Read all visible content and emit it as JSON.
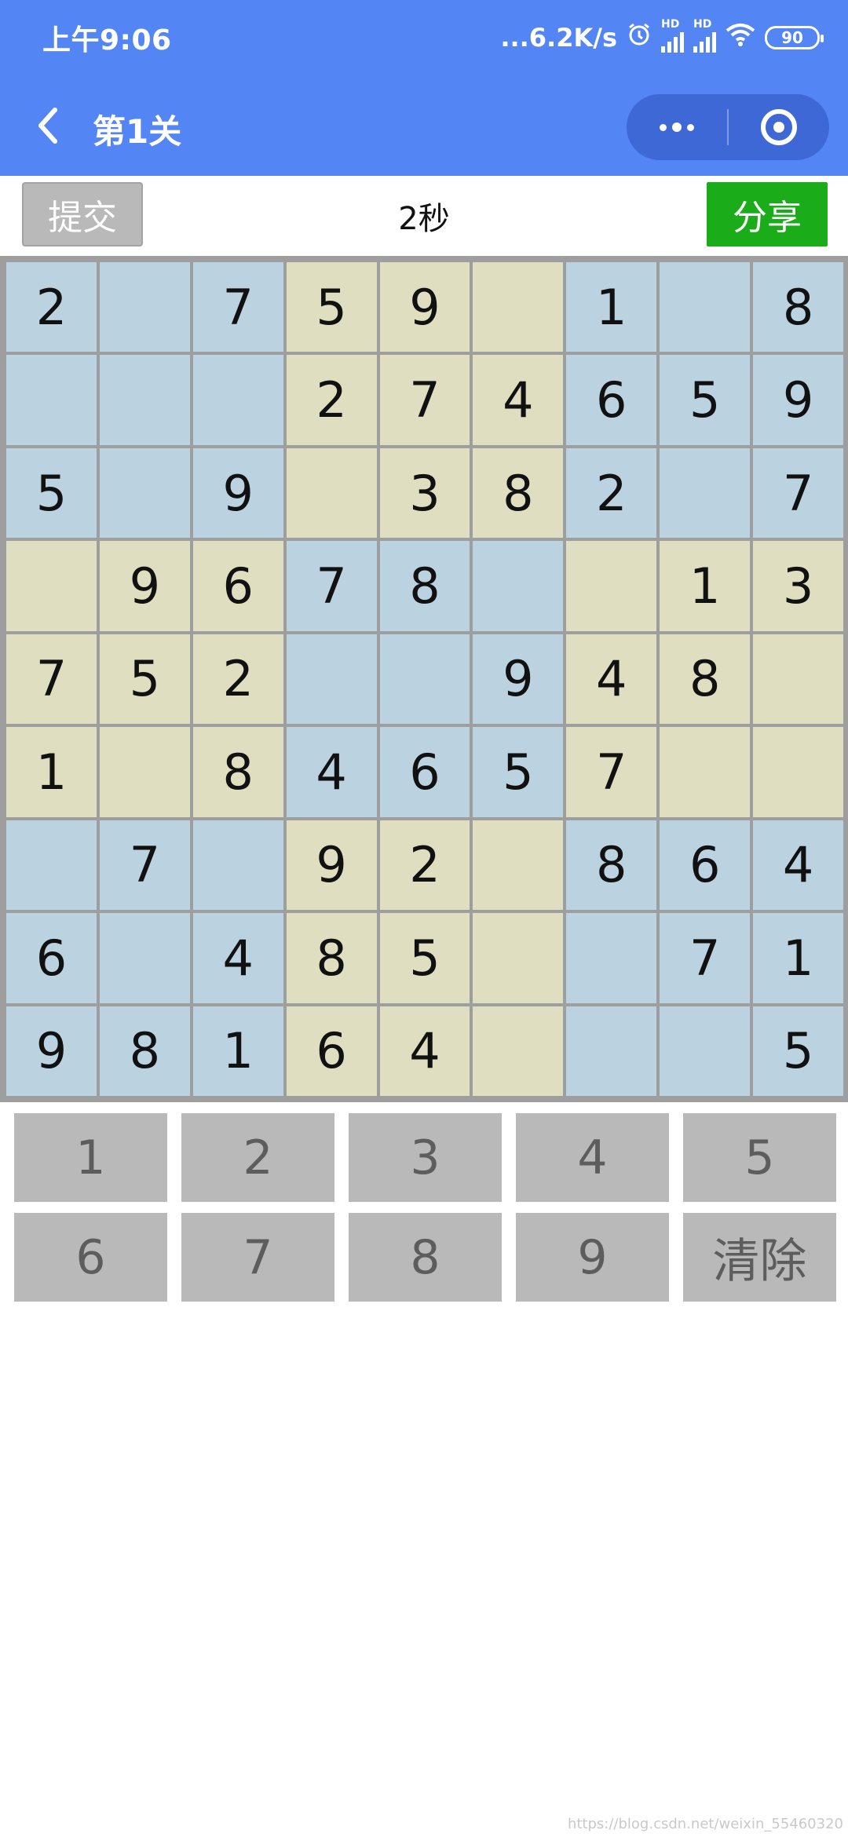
{
  "status_bar": {
    "time": "上午9:06",
    "network_speed": "...6.2K/s",
    "signal_label_1": "HD",
    "signal_label_2": "HD",
    "battery": "90",
    "icons": [
      "alarm-icon",
      "signal-icon",
      "signal-icon",
      "wifi-icon",
      "battery-icon"
    ]
  },
  "nav": {
    "title": "第1关",
    "back_icon": "chevron-left-icon",
    "menu_icon": "more-dots-icon",
    "close_icon": "target-circle-icon"
  },
  "toolbar": {
    "submit_label": "提交",
    "timer": "2秒",
    "share_label": "分享"
  },
  "colors": {
    "header": "#5485f4",
    "capsule": "#3d68d6",
    "share": "#1aad19",
    "submit": "#b9b9b9",
    "cell_blue": "#bbd2e1",
    "cell_yellow": "#e0dec0",
    "grid_line": "#9e9e9e",
    "key": "#b9b9b9"
  },
  "board": {
    "rows": [
      [
        "2",
        "",
        "7",
        "5",
        "9",
        "",
        "1",
        "",
        "8"
      ],
      [
        "",
        "",
        "",
        "2",
        "7",
        "4",
        "6",
        "5",
        "9"
      ],
      [
        "5",
        "",
        "9",
        "",
        "3",
        "8",
        "2",
        "",
        "7"
      ],
      [
        "",
        "9",
        "6",
        "7",
        "8",
        "",
        "",
        "1",
        "3"
      ],
      [
        "7",
        "5",
        "2",
        "",
        "",
        "9",
        "4",
        "8",
        ""
      ],
      [
        "1",
        "",
        "8",
        "4",
        "6",
        "5",
        "7",
        "",
        ""
      ],
      [
        "",
        "7",
        "",
        "9",
        "2",
        "",
        "8",
        "6",
        "4"
      ],
      [
        "6",
        "",
        "4",
        "8",
        "5",
        "",
        "",
        "7",
        "1"
      ],
      [
        "9",
        "8",
        "1",
        "6",
        "4",
        "",
        "",
        "",
        "5"
      ]
    ],
    "block_colors": [
      [
        "blue",
        "yellow",
        "blue"
      ],
      [
        "yellow",
        "blue",
        "yellow"
      ],
      [
        "blue",
        "yellow",
        "blue"
      ]
    ]
  },
  "keypad": {
    "keys": [
      "1",
      "2",
      "3",
      "4",
      "5",
      "6",
      "7",
      "8",
      "9",
      "清除"
    ]
  },
  "watermark": "https://blog.csdn.net/weixin_55460320"
}
